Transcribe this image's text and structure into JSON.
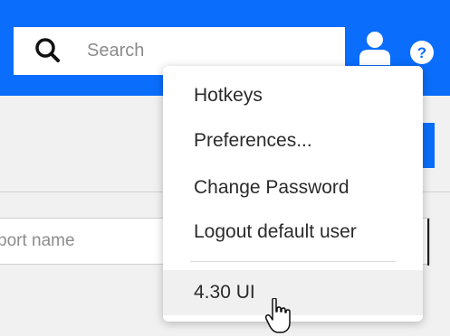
{
  "search": {
    "placeholder": "Search"
  },
  "user_menu": {
    "items": [
      {
        "label": "Hotkeys"
      },
      {
        "label": "Preferences..."
      },
      {
        "label": "Change Password"
      },
      {
        "label": "Logout default user"
      }
    ],
    "version_label": "4.30 UI"
  },
  "report": {
    "placeholder": "port name"
  },
  "colors": {
    "accent": "#0a6dfb",
    "menu_hover": "#f0f0f0"
  },
  "icons": {
    "search": "search-icon",
    "user": "user-icon",
    "help": "help-icon",
    "cursor": "hand-pointer-cursor"
  }
}
